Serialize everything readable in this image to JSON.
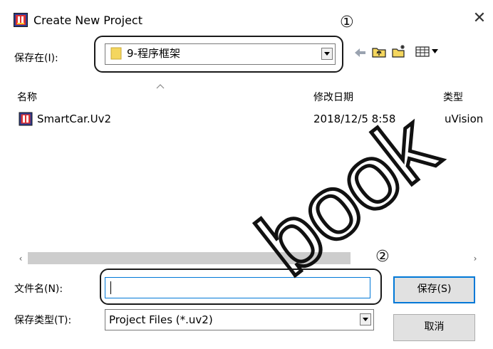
{
  "window": {
    "title": "Create New Project",
    "close_symbol": "✕"
  },
  "save_in": {
    "label": "保存在(I):",
    "value": "9-程序框架"
  },
  "toolbar": {
    "icons": [
      "back-arrow-icon",
      "up-folder-icon",
      "new-folder-icon",
      "views-menu-icon"
    ]
  },
  "list": {
    "columns": [
      "名称",
      "修改日期",
      "类型"
    ],
    "rows": [
      {
        "name": "SmartCar.Uv2",
        "date": "2018/12/5 8:58",
        "type": "uVision"
      }
    ]
  },
  "scrollbar": {
    "left_arrow": "‹",
    "right_arrow": "›"
  },
  "file_name": {
    "label": "文件名(N):",
    "value": ""
  },
  "file_type": {
    "label": "保存类型(T):",
    "value": "Project Files (*.uv2)"
  },
  "buttons": {
    "save": "保存(S)",
    "cancel": "取消"
  },
  "annotations": {
    "marker_1": "①",
    "marker_2": "②"
  },
  "watermark": "book",
  "colors": {
    "accent": "#0078d7",
    "folder": "#f4d65e",
    "scroll_thumb": "#cdcdcd"
  }
}
